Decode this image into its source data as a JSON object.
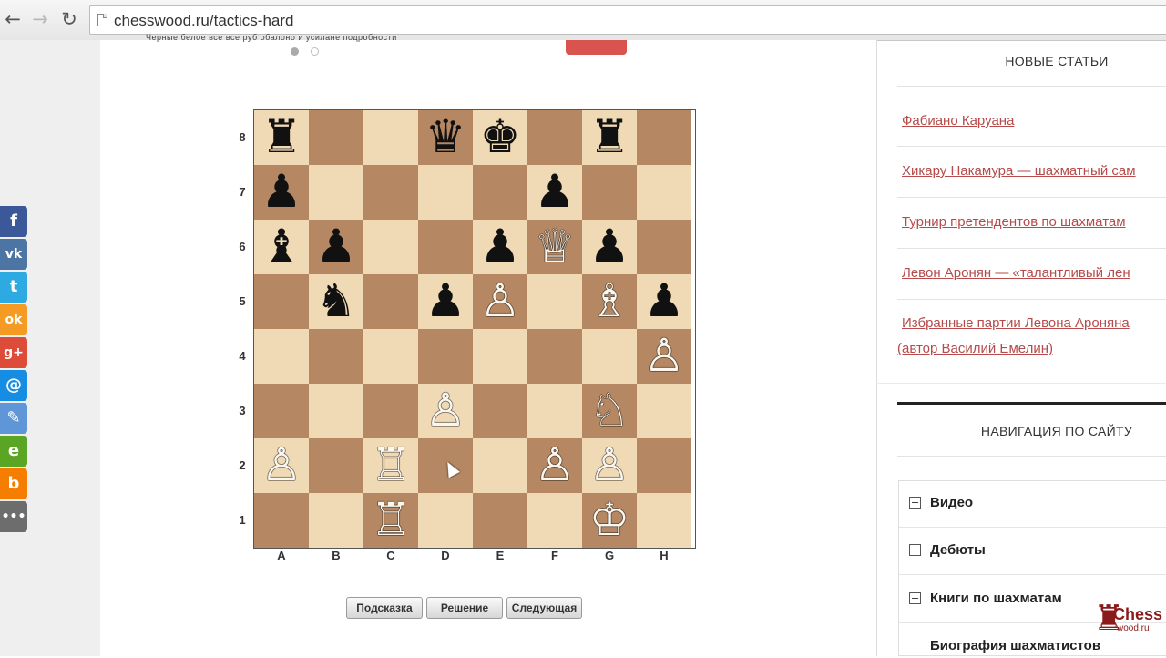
{
  "browser": {
    "back_icon": "arrow-left-icon",
    "forward_icon": "arrow-right-icon",
    "reload_icon": "reload-icon",
    "url": "chesswood.ru/tactics-hard"
  },
  "header_snippet": "Черные белое все все руб обалоно и усилане подробности",
  "share": [
    {
      "name": "facebook-icon",
      "glyph": "f",
      "color": "#3b5998"
    },
    {
      "name": "vk-icon",
      "glyph": "vk",
      "color": "#4c75a3"
    },
    {
      "name": "twitter-icon",
      "glyph": "t",
      "color": "#2daae1"
    },
    {
      "name": "odnoklassniki-icon",
      "glyph": "ok",
      "color": "#f59a22"
    },
    {
      "name": "google-plus-icon",
      "glyph": "g+",
      "color": "#dd4b39"
    },
    {
      "name": "mail-icon",
      "glyph": "@",
      "color": "#168de2"
    },
    {
      "name": "livejournal-icon",
      "glyph": "✎",
      "color": "#5e96d7"
    },
    {
      "name": "evernote-icon",
      "glyph": "e",
      "color": "#5ba525"
    },
    {
      "name": "blogger-icon",
      "glyph": "b",
      "color": "#f57d00"
    },
    {
      "name": "more-icon",
      "glyph": "•••",
      "color": "#6d6d6d"
    }
  ],
  "board": {
    "files": [
      "A",
      "B",
      "C",
      "D",
      "E",
      "F",
      "G",
      "H"
    ],
    "ranks": [
      "8",
      "7",
      "6",
      "5",
      "4",
      "3",
      "2",
      "1"
    ],
    "pieces": [
      {
        "sq": "a8",
        "glyph": "♜",
        "color": "black",
        "name": "rook"
      },
      {
        "sq": "d8",
        "glyph": "♛",
        "color": "black",
        "name": "queen"
      },
      {
        "sq": "e8",
        "glyph": "♚",
        "color": "black",
        "name": "king"
      },
      {
        "sq": "g8",
        "glyph": "♜",
        "color": "black",
        "name": "rook"
      },
      {
        "sq": "a7",
        "glyph": "♟",
        "color": "black",
        "name": "pawn"
      },
      {
        "sq": "f7",
        "glyph": "♟",
        "color": "black",
        "name": "pawn"
      },
      {
        "sq": "a6",
        "glyph": "♝",
        "color": "black",
        "name": "bishop"
      },
      {
        "sq": "b6",
        "glyph": "♟",
        "color": "black",
        "name": "pawn"
      },
      {
        "sq": "e6",
        "glyph": "♟",
        "color": "black",
        "name": "pawn"
      },
      {
        "sq": "f6",
        "glyph": "♕",
        "color": "white",
        "name": "queen"
      },
      {
        "sq": "g6",
        "glyph": "♟",
        "color": "black",
        "name": "pawn"
      },
      {
        "sq": "b5",
        "glyph": "♞",
        "color": "black",
        "name": "knight"
      },
      {
        "sq": "d5",
        "glyph": "♟",
        "color": "black",
        "name": "pawn"
      },
      {
        "sq": "e5",
        "glyph": "♙",
        "color": "white",
        "name": "pawn"
      },
      {
        "sq": "g5",
        "glyph": "♗",
        "color": "white",
        "name": "bishop"
      },
      {
        "sq": "h5",
        "glyph": "♟",
        "color": "black",
        "name": "pawn"
      },
      {
        "sq": "h4",
        "glyph": "♙",
        "color": "white",
        "name": "pawn"
      },
      {
        "sq": "d3",
        "glyph": "♙",
        "color": "white",
        "name": "pawn"
      },
      {
        "sq": "g3",
        "glyph": "♘",
        "color": "white",
        "name": "knight"
      },
      {
        "sq": "a2",
        "glyph": "♙",
        "color": "white",
        "name": "pawn"
      },
      {
        "sq": "c2",
        "glyph": "♖",
        "color": "white",
        "name": "rook"
      },
      {
        "sq": "f2",
        "glyph": "♙",
        "color": "white",
        "name": "pawn"
      },
      {
        "sq": "g2",
        "glyph": "♙",
        "color": "white",
        "name": "pawn"
      },
      {
        "sq": "c1",
        "glyph": "♖",
        "color": "white",
        "name": "rook"
      },
      {
        "sq": "g1",
        "glyph": "♔",
        "color": "white",
        "name": "king"
      }
    ]
  },
  "actions": {
    "hint": "Подсказка",
    "solution": "Решение",
    "next": "Следующая"
  },
  "sidebar": {
    "new_articles_title": "НОВЫЕ СТАТЬИ",
    "articles": [
      "Фабиано Каруана",
      "Хикару Накамура — шахматный сам",
      "Турнир претендентов по шахматам",
      "Левон Аронян — «талантливый лен",
      "Избранные партии Левона Ароняна",
      "(автор Василий Емелин)"
    ],
    "nav_title": "НАВИГАЦИЯ ПО САЙТУ",
    "nav_items": [
      "Видео",
      "Дебюты",
      "Книги по шахматам",
      "Биография шахматистов"
    ]
  },
  "logo": {
    "line1": "Chess",
    "line2": "wood.ru"
  }
}
